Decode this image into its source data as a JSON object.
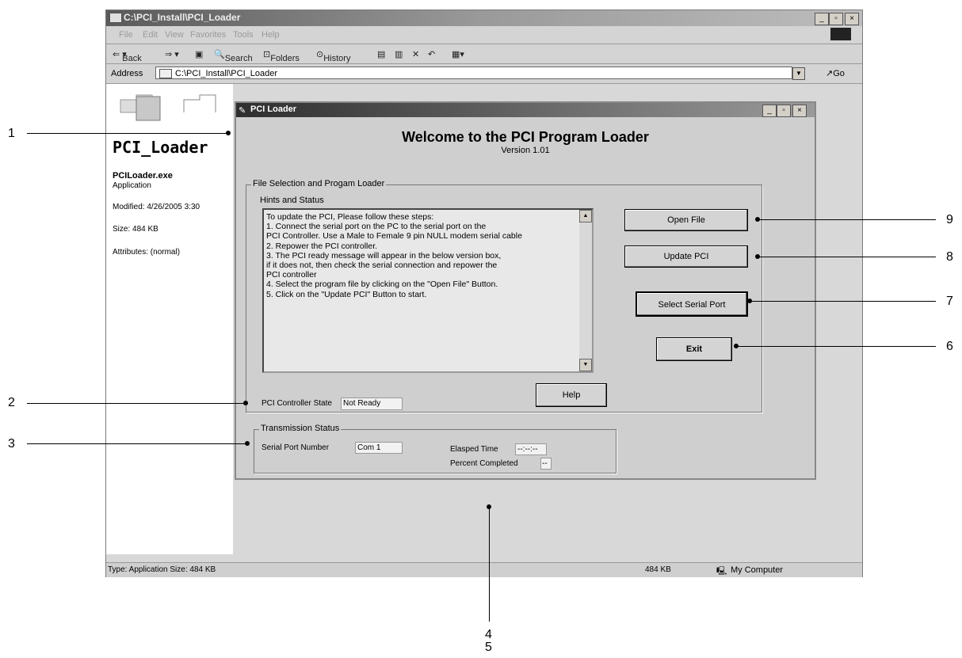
{
  "explorer": {
    "title": "C:\\PCI_Install\\PCI_Loader",
    "menu": [
      "File",
      "Edit",
      "View",
      "Favorites",
      "Tools",
      "Help"
    ],
    "toolbar": {
      "back": "Back",
      "search": "Search",
      "folders": "Folders",
      "history": "History"
    },
    "address_label": "Address",
    "address_value": "C:\\PCI_Install\\PCI_Loader",
    "go_label": "Go",
    "folder_name": "PCI_Loader",
    "file_name": "PCILoader.exe",
    "file_type": "Application",
    "modified": "Modified: 4/26/2005 3:30",
    "size": "Size: 484 KB",
    "attributes": "Attributes: (normal)",
    "status_left": "Type: Application Size: 484 KB",
    "status_size": "484 KB",
    "status_zone": "My Computer"
  },
  "dialog": {
    "title": "PCI Loader",
    "welcome": "Welcome to the PCI  Program Loader",
    "version": "Version 1.01",
    "group_file": "File Selection and Progam Loader",
    "hints_label": "Hints and Status",
    "hints": [
      "To update the PCI, Please follow these steps:",
      "1. Connect the serial port on the PC to the serial port on the",
      "    PCI Controller. Use a Male to Female 9 pin NULL modem serial cable",
      "2. Repower the PCI controller.",
      "3. The PCI ready message will appear in the below version box,",
      "    if it does not, then check the serial connection and repower the",
      "    PCI controller",
      "4. Select the  program file by clicking on the \"Open File\" Button.",
      "5. Click on the \"Update PCI\" Button to start."
    ],
    "open_file": "Open File",
    "update_pci": "Update PCI",
    "select_serial": "Select  Serial Port",
    "exit": "Exit",
    "help": "Help",
    "state_label": "PCI Controller State",
    "state_value": "Not Ready",
    "group_trans": "Transmission Status",
    "serial_label": "Serial Port Number",
    "serial_value": "Com 1",
    "elapsed_label": "Elasped Time",
    "elapsed_value": "--:--:--",
    "percent_label": "Percent Completed",
    "percent_value": "--"
  },
  "callouts": [
    "1",
    "2",
    "3",
    "4",
    "5",
    "6",
    "7",
    "8",
    "9"
  ]
}
